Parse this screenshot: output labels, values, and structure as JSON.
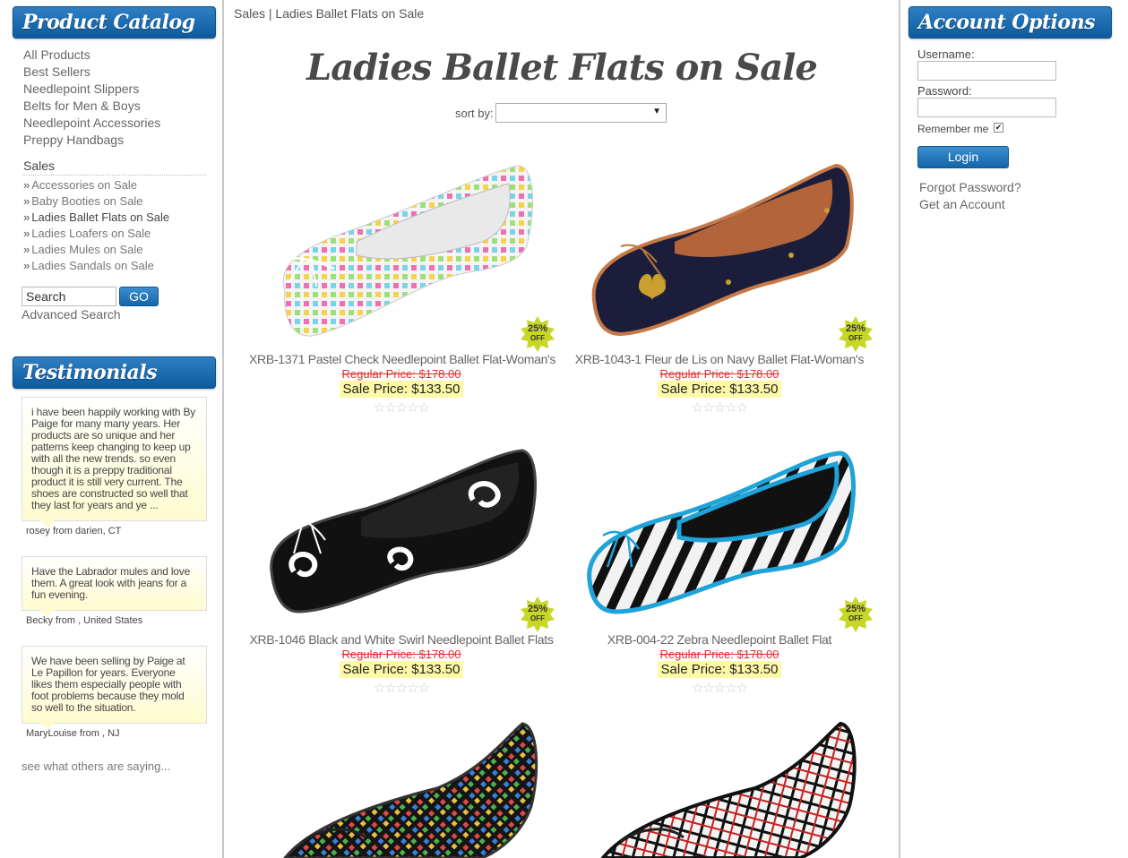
{
  "left": {
    "catalog_title": "Product Catalog",
    "catalog_items": [
      "All Products",
      "Best Sellers",
      "Needlepoint Slippers",
      "Belts for Men & Boys",
      "Needlepoint Accessories",
      "Preppy Handbags"
    ],
    "sales_title": "Sales",
    "sales_items": [
      "Accessories on Sale",
      "Baby Booties on Sale",
      "Ladies Ballet Flats on Sale",
      "Ladies Loafers on Sale",
      "Ladies Mules on Sale",
      "Ladies Sandals on Sale"
    ],
    "sales_marker": "»",
    "search_value": "Search",
    "go_label": "GO",
    "advanced_search": "Advanced Search",
    "testimonials_title": "Testimonials",
    "testimonials": [
      {
        "text": "i have been happily working with By Paige for many many years. Her products are so unique and her patterns keep changing to keep up with all the new trends. so even though it is a preppy traditional product it is still very current. The shoes are constructed so well that they last for years and ye ...",
        "by": "rosey from darien, CT"
      },
      {
        "text": "Have the Labrador mules and love them. A great look with jeans for a fun evening.",
        "by": "Becky from , United States"
      },
      {
        "text": "We have been selling by Paige at Le Papillon for years. Everyone likes them especially people with foot problems because they mold so well to the situation.",
        "by": "MaryLouise from , NJ"
      }
    ],
    "see_more": "see what others are saying..."
  },
  "center": {
    "breadcrumb": "Sales | Ladies Ballet Flats on Sale",
    "page_title": "Ladies Ballet Flats on Sale",
    "sort_label": "sort by:",
    "sort_value": "",
    "badge_pct": "25%",
    "badge_off": "OFF",
    "stars": "☆☆☆☆☆",
    "products": [
      {
        "name": "XRB-1371 Pastel Check Needlepoint Ballet Flat-Woman's",
        "regular": "Regular Price: $178.00",
        "sale": "Sale Price: $133.50"
      },
      {
        "name": "XRB-1043-1 Fleur de Lis on Navy Ballet Flat-Woman's",
        "regular": "Regular Price: $178.00",
        "sale": "Sale Price: $133.50"
      },
      {
        "name": "XRB-1046 Black and White Swirl Needlepoint Ballet Flats",
        "regular": "Regular Price: $178.00",
        "sale": "Sale Price: $133.50"
      },
      {
        "name": "XRB-004-22 Zebra Needlepoint Ballet Flat",
        "regular": "Regular Price: $178.00",
        "sale": "Sale Price: $133.50"
      }
    ]
  },
  "right": {
    "title": "Account Options",
    "username_label": "Username:",
    "password_label": "Password:",
    "remember_label": "Remember me",
    "remember_checked": "✔",
    "login_label": "Login",
    "forgot": "Forgot Password?",
    "get_account": "Get an Account"
  }
}
